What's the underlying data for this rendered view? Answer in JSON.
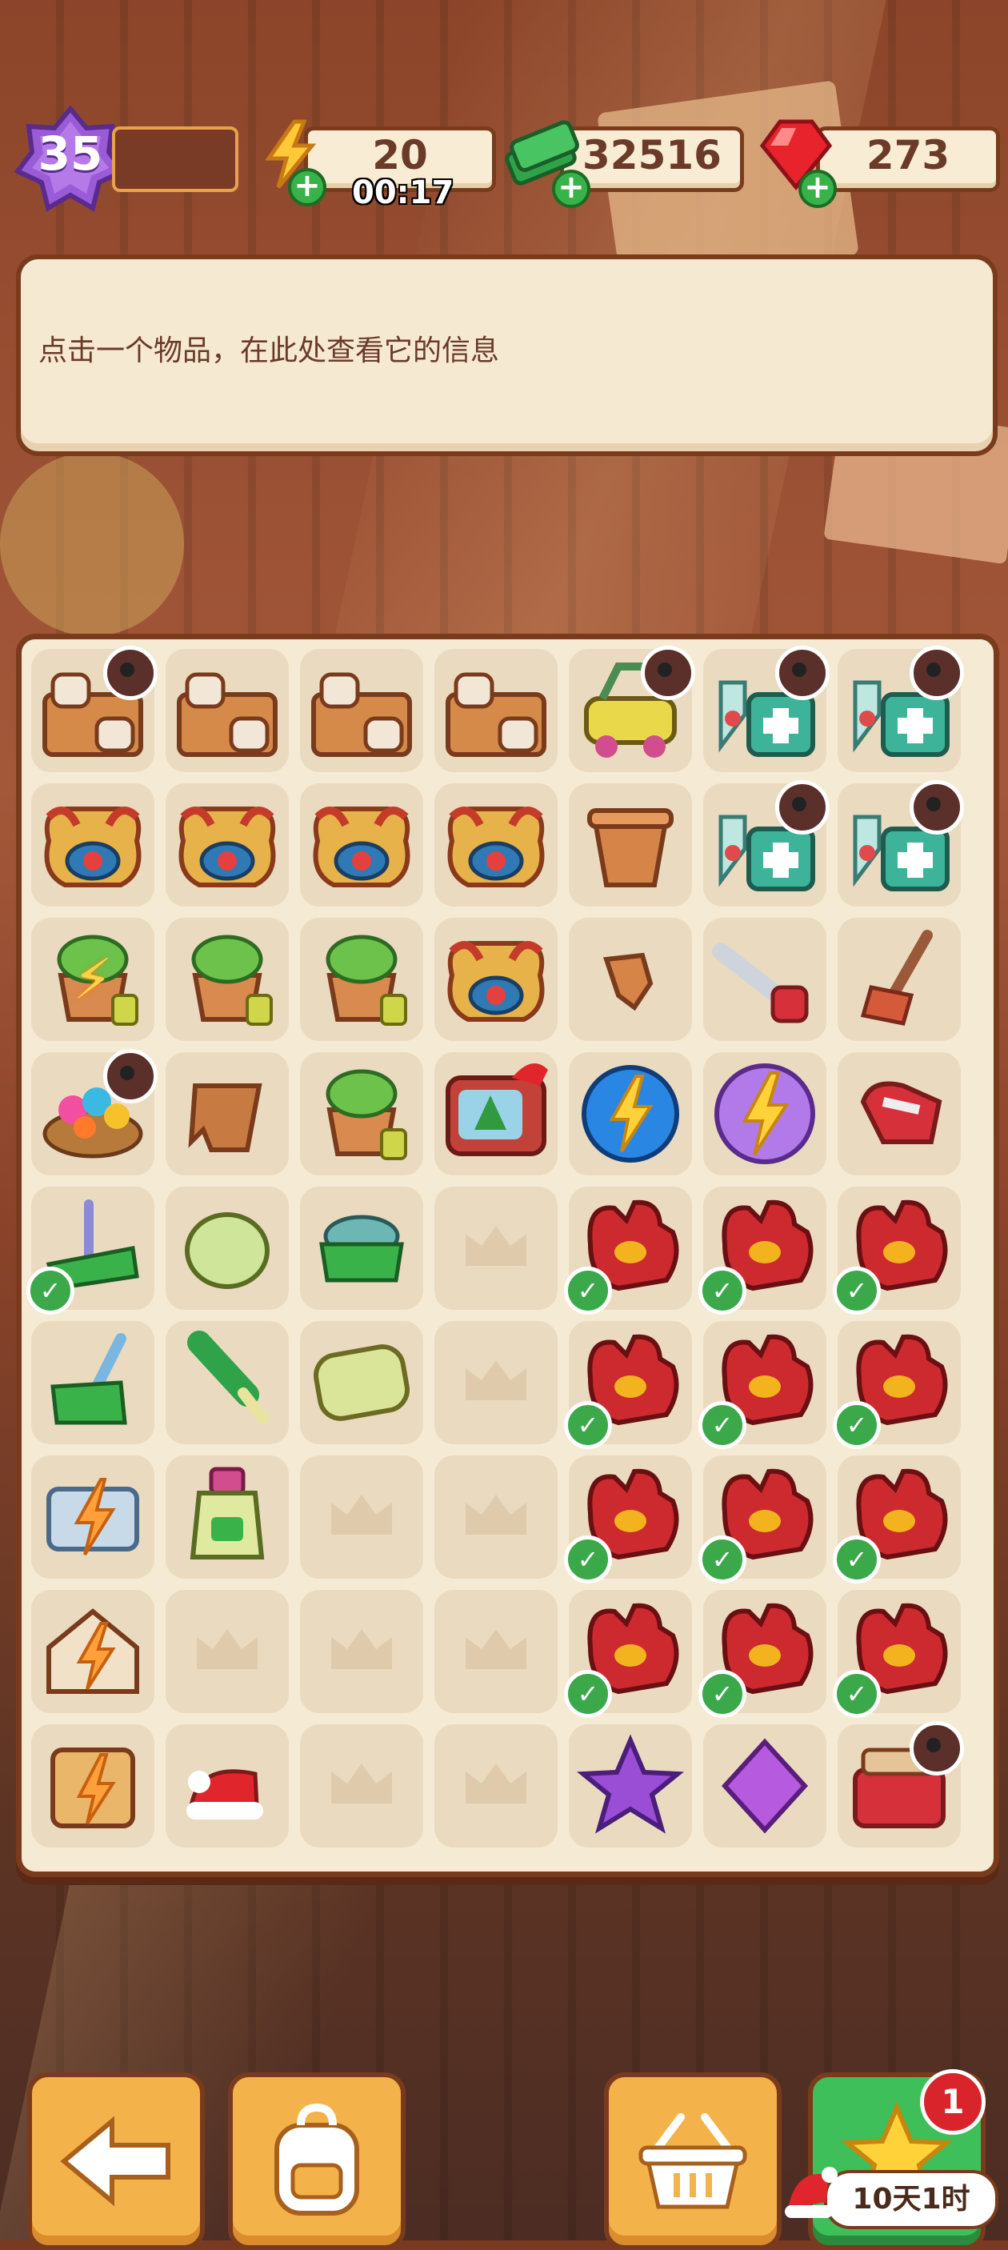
{
  "hud": {
    "level": "35",
    "energy": "20",
    "energy_timer": "00:17",
    "cash": "32516",
    "gems": "273"
  },
  "info_panel": {
    "text": "点击一个物品，在此处查看它的信息"
  },
  "board": {
    "cols": 7,
    "rows": 9,
    "cells": [
      [
        "crate-pottery-locked",
        "crate-pottery",
        "crate-pottery",
        "crate-pottery",
        "golf-cart-locked",
        "medkit-locked",
        "medkit-locked"
      ],
      [
        "dragon-vase",
        "dragon-vase",
        "dragon-vase",
        "dragon-vase",
        "clay-pot",
        "medkit-locked",
        "medkit-locked"
      ],
      [
        "plant-pot-energy",
        "plant-pot",
        "plant-pot",
        "dragon-vase",
        "pot-shard",
        "hand-saw",
        "broom"
      ],
      [
        "flower-basket-locked",
        "broken-pot",
        "plant-pot",
        "christmas-tv",
        "energy-orb-blue",
        "energy-orb-purple",
        "glove-small"
      ],
      [
        "cleaning-brush-done",
        "soap-bar",
        "scrub-brush",
        "empty",
        "red-glove-done",
        "red-glove-done",
        "red-glove-done"
      ],
      [
        "dustpan",
        "bristle-brush",
        "shanghai-soap",
        "empty",
        "red-glove-done",
        "red-glove-done",
        "red-glove-done"
      ],
      [
        "energy-case",
        "lotion-bottle",
        "empty",
        "empty",
        "red-glove-done",
        "red-glove-done",
        "red-glove-done"
      ],
      [
        "energy-house",
        "empty",
        "empty",
        "empty",
        "red-glove-done",
        "red-glove-done",
        "red-glove-done"
      ],
      [
        "energy-crate",
        "santa-hat",
        "empty",
        "empty",
        "purple-star",
        "purple-gem",
        "toolbox-locked"
      ]
    ]
  },
  "bottom_bar": {
    "back_icon": "arrow-left-icon",
    "bag_icon": "backpack-icon",
    "shop_icon": "basket-icon",
    "event_icon": "star-icon",
    "event_badge": "1",
    "event_timer": "10天1时"
  },
  "colors": {
    "accent": "#f4b24a",
    "panel": "#f5ead3",
    "border": "#7a3b1d",
    "done_green": "#3ba84a"
  }
}
